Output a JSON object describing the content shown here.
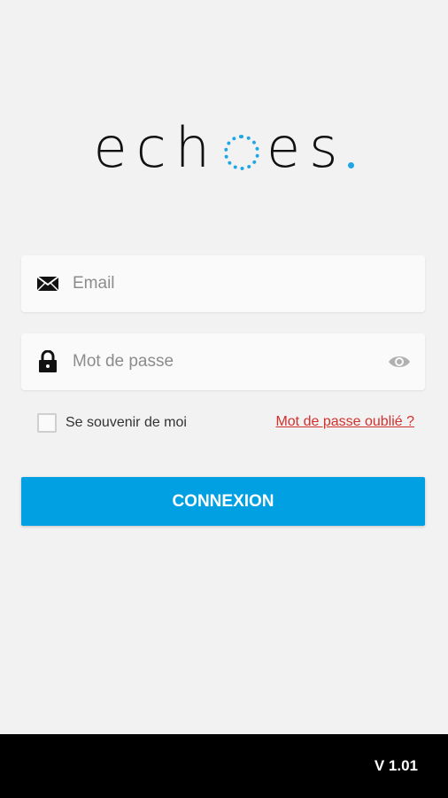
{
  "logo": {
    "part1": "ech",
    "part2": "es"
  },
  "login": {
    "email_placeholder": "Email",
    "password_placeholder": "Mot de passe",
    "remember_label": "Se souvenir de moi",
    "forgot_label": "Mot de passe oublié ?",
    "submit_label": "CONNEXION"
  },
  "footer": {
    "version": "V 1.01"
  },
  "colors": {
    "accent": "#00a0e3",
    "logo_blue": "#1ea6e6",
    "link_red": "#d0312d",
    "footer_bg": "#000000"
  },
  "icons": {
    "email": "envelope-icon",
    "password": "lock-icon",
    "toggle": "eye-icon"
  }
}
